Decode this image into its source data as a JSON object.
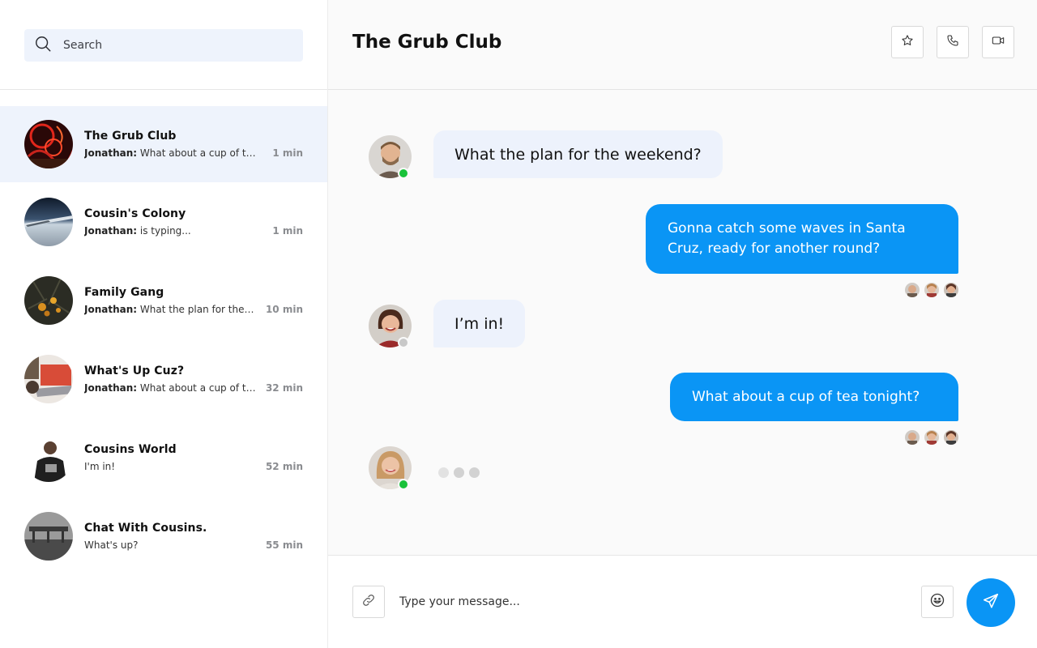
{
  "sidebar": {
    "search": {
      "placeholder": "Search",
      "icon": "search-icon"
    },
    "conversations": [
      {
        "name": "The Grub Club",
        "sender": "Jonathan:",
        "preview": "What about a cup of tea tonight?",
        "time": "1 min",
        "active": true,
        "avatar_colors": [
          "#3a0d0d",
          "#c8231c"
        ]
      },
      {
        "name": "Cousin's Colony",
        "sender": "Jonathan:",
        "preview": "is typing...",
        "time": "1 min",
        "active": false,
        "avatar_colors": [
          "#1e2c3e",
          "#c9d2da"
        ]
      },
      {
        "name": "Family Gang",
        "sender": "Jonathan:",
        "preview": "What the plan for the weekend?",
        "time": "10 min",
        "active": false,
        "avatar_colors": [
          "#2a2a22",
          "#c98a1e"
        ]
      },
      {
        "name": "What's Up Cuz?",
        "sender": "Jonathan:",
        "preview": "What about a cup of tea tonight?",
        "time": "32 min",
        "active": false,
        "avatar_colors": [
          "#d04a36",
          "#efe9e4"
        ]
      },
      {
        "name": "Cousins World",
        "sender": "",
        "preview": "I'm in!",
        "time": "52 min",
        "active": false,
        "avatar_colors": [
          "#ffffff",
          "#222222"
        ]
      },
      {
        "name": "Chat With Cousins.",
        "sender": "",
        "preview": "What's up?",
        "time": "55 min",
        "active": false,
        "avatar_colors": [
          "#444444",
          "#a8a8a8"
        ]
      }
    ]
  },
  "header": {
    "title": "The Grub Club",
    "actions": [
      "star-icon",
      "phone-icon",
      "video-icon"
    ]
  },
  "messages": [
    {
      "direction": "in",
      "text": "What the plan for the weekend?",
      "sender_status": "online"
    },
    {
      "direction": "out",
      "text": "Gonna catch some waves in Santa Cruz, ready for another round?",
      "read_by": 3
    },
    {
      "direction": "in",
      "text": "I’m in!",
      "sender_status": "offline"
    },
    {
      "direction": "out",
      "text": "What about a cup of tea tonight?",
      "read_by": 3
    },
    {
      "direction": "typing",
      "sender_status": "online"
    }
  ],
  "composer": {
    "placeholder": "Type your message...",
    "icons": [
      "link-icon",
      "smile-icon",
      "send-icon"
    ]
  },
  "colors": {
    "accent": "#0a95f5",
    "incoming_bubble": "#edf2fc",
    "active_row": "#eef3fc",
    "online": "#19c23a",
    "offline": "#c8c8c8"
  }
}
